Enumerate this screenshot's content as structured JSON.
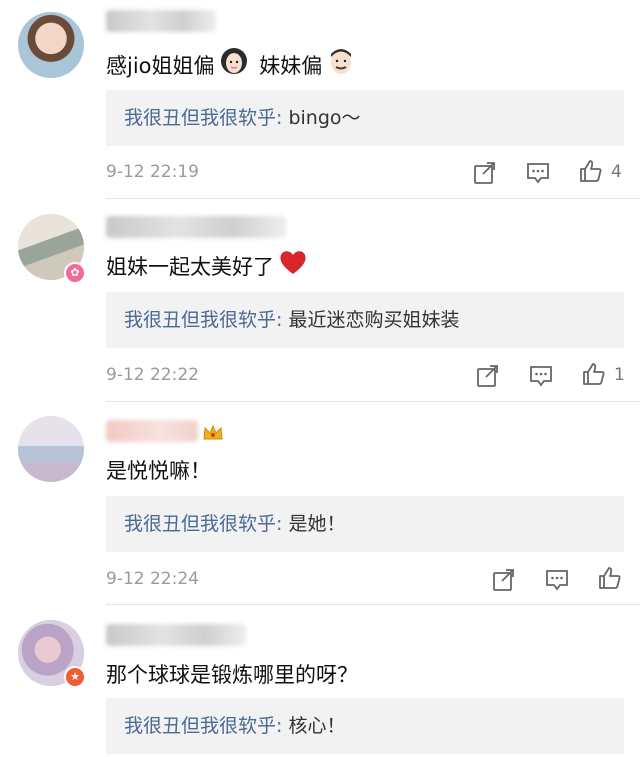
{
  "comments": [
    {
      "text_pre": "感jio姐姐偏",
      "text_mid": "妹妹偏",
      "reply_author": "我很丑但我很软乎",
      "reply_text": "bingo～",
      "timestamp": "9-12 22:19",
      "likes": "4"
    },
    {
      "text": "姐妹一起太美好了",
      "reply_author": "我很丑但我很软乎",
      "reply_text": "最近迷恋购买姐妹装",
      "timestamp": "9-12 22:22",
      "likes": "1"
    },
    {
      "text": "是悦悦嘛！",
      "reply_author": "我很丑但我很软乎",
      "reply_text": "是她！",
      "timestamp": "9-12 22:24",
      "likes": ""
    },
    {
      "text": "那个球球是锻炼哪里的呀？",
      "reply_author": "我很丑但我很软乎",
      "reply_text": "核心！",
      "timestamp": "",
      "likes": ""
    }
  ],
  "reply_separator": ": ",
  "colors": {
    "reply_author": "#4b6a96",
    "reply_bg": "#f2f2f2",
    "meta": "#9a9a9a"
  },
  "icons": [
    "share-icon",
    "comment-icon",
    "like-icon",
    "heart-icon",
    "crown-icon",
    "woman-emoji-icon",
    "man-emoji-icon"
  ]
}
